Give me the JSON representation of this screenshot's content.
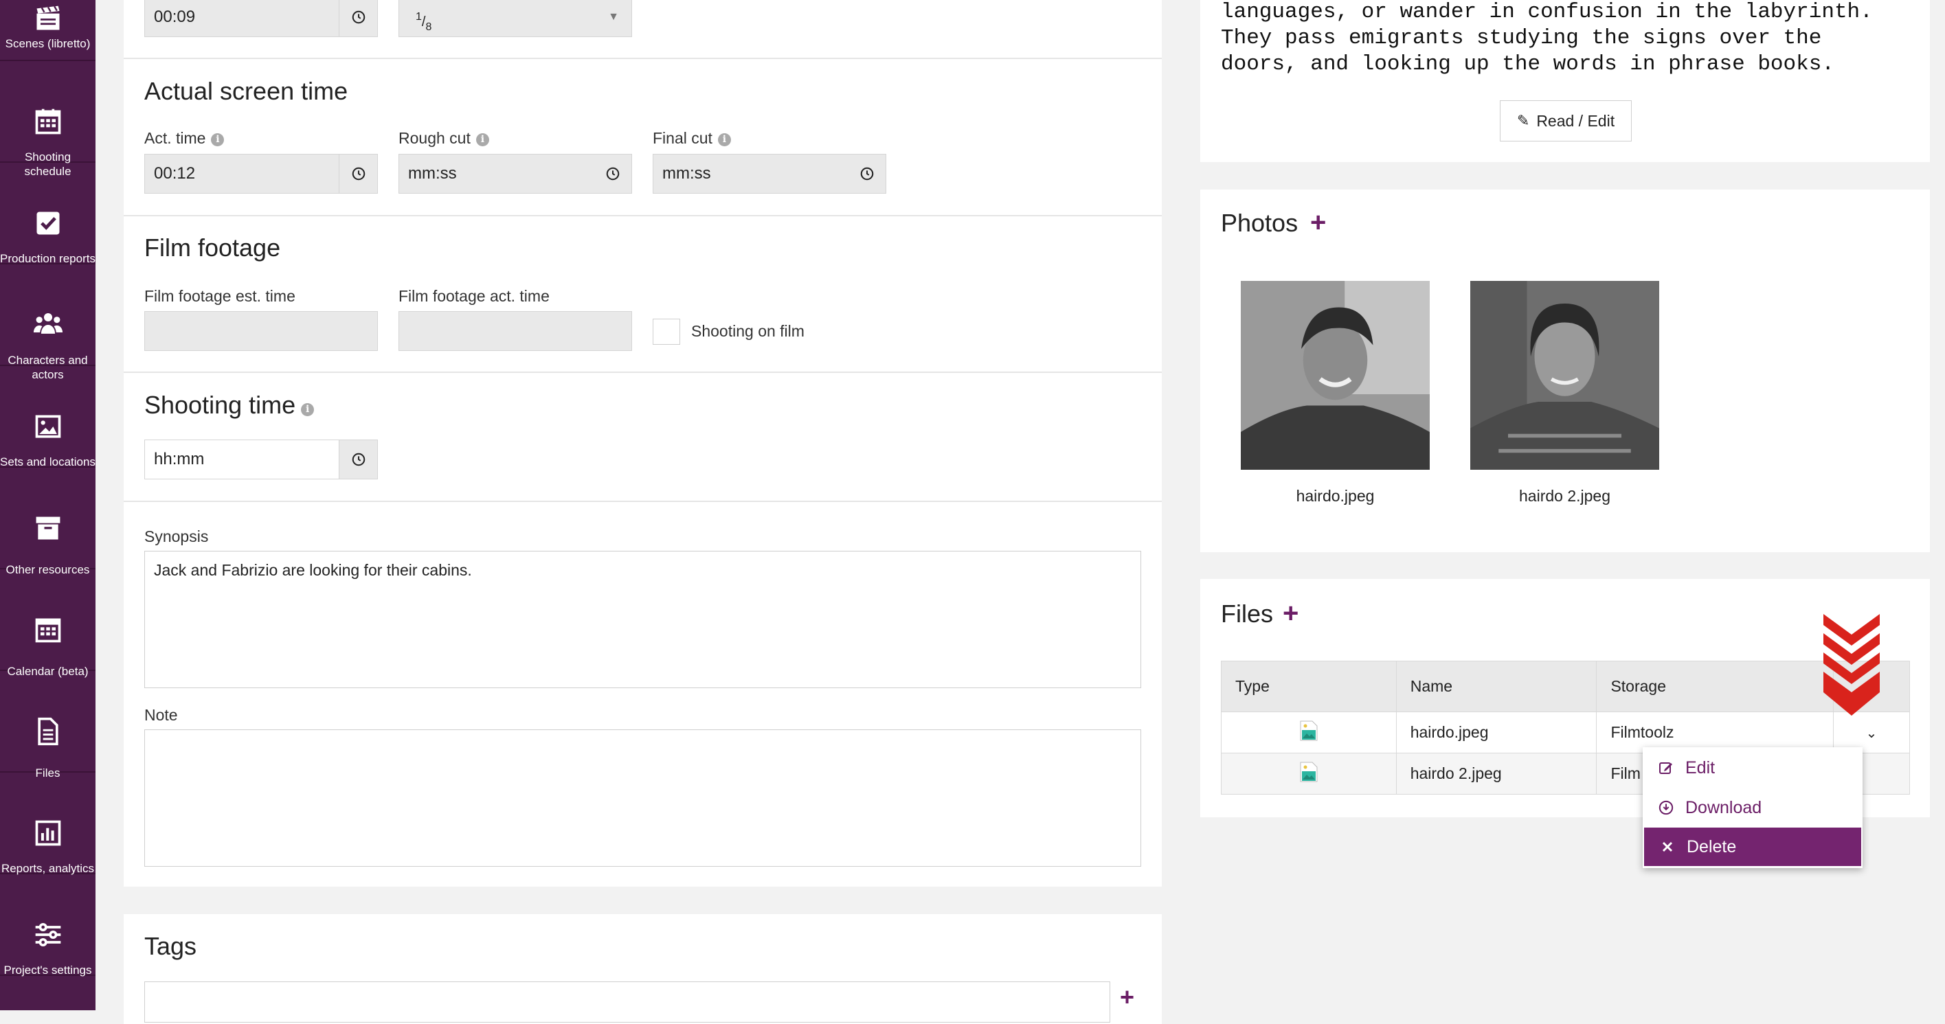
{
  "sidebar": {
    "items": [
      {
        "label": "Scenes (libretto)",
        "icon": "clapperboard-icon"
      },
      {
        "label": "Shooting schedule",
        "icon": "calendar-grid-icon"
      },
      {
        "label": "Production reports",
        "icon": "checkbox-icon"
      },
      {
        "label": "Characters and actors",
        "icon": "people-icon"
      },
      {
        "label": "Sets and locations",
        "icon": "image-icon"
      },
      {
        "label": "Other resources",
        "icon": "archive-box-icon"
      },
      {
        "label": "Calendar (beta)",
        "icon": "calendar-icon"
      },
      {
        "label": "Files",
        "icon": "file-icon"
      },
      {
        "label": "Reports, analytics",
        "icon": "bar-chart-icon"
      },
      {
        "label": "Project's settings",
        "icon": "sliders-icon"
      }
    ]
  },
  "top_row": {
    "time_value": "00:09",
    "fraction_numerator": "1",
    "fraction_denominator": "8"
  },
  "actual_screen_time": {
    "title": "Actual screen time",
    "act_time_label": "Act. time",
    "act_time_value": "00:12",
    "rough_cut_label": "Rough cut",
    "rough_cut_placeholder": "mm:ss",
    "final_cut_label": "Final cut",
    "final_cut_placeholder": "mm:ss"
  },
  "film_footage": {
    "title": "Film footage",
    "est_label": "Film footage est. time",
    "act_label": "Film footage act. time",
    "shooting_on_film_label": "Shooting on film"
  },
  "shooting_time": {
    "title": "Shooting time",
    "placeholder": "hh:mm"
  },
  "synopsis": {
    "label": "Synopsis",
    "value": "Jack and Fabrizio are looking for their cabins."
  },
  "note": {
    "label": "Note",
    "value": ""
  },
  "tags": {
    "title": "Tags"
  },
  "script_text": {
    "lines": [
      "languages, or wander in confusion in the labyrinth.",
      "They pass emigrants studying the signs over the",
      "doors, and looking up the words in phrase books."
    ],
    "read_edit_label": "Read / Edit"
  },
  "photos": {
    "title": "Photos",
    "items": [
      {
        "caption": "hairdo.jpeg"
      },
      {
        "caption": "hairdo 2.jpeg"
      }
    ]
  },
  "files": {
    "title": "Files",
    "columns": [
      "Type",
      "Name",
      "Storage"
    ],
    "rows": [
      {
        "name": "hairdo.jpeg",
        "storage": "Filmtoolz"
      },
      {
        "name": "hairdo 2.jpeg",
        "storage": "Film"
      }
    ]
  },
  "context_menu": {
    "items": [
      {
        "label": "Edit",
        "icon": "edit-icon"
      },
      {
        "label": "Download",
        "icon": "download-icon"
      },
      {
        "label": "Delete",
        "icon": "close-icon"
      }
    ]
  },
  "colors": {
    "sidebar_bg": "#4c1c4a",
    "accent": "#6b1d66",
    "menu_active": "#74246f",
    "arrow": "#d9231c"
  }
}
